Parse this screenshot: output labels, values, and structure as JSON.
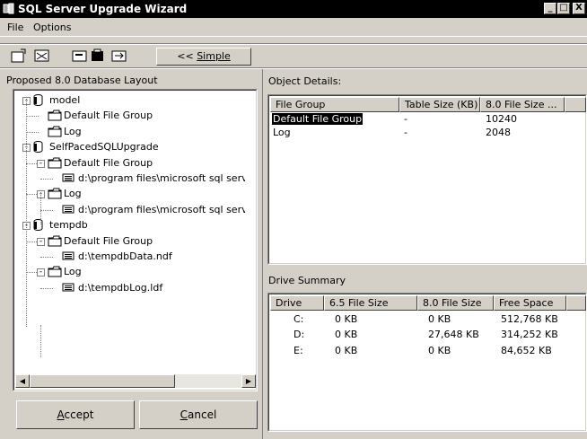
{
  "window": {
    "title": "SQL Server Upgrade Wizard",
    "controls": [
      "_",
      "□",
      "X"
    ]
  },
  "menu": {
    "items": [
      "File",
      "Options"
    ]
  },
  "toolbar": {
    "simple_prefix": "<< ",
    "simple_label": "Simple"
  },
  "left_panel": {
    "label": "Proposed 8.0 Database Layout",
    "tree": [
      {
        "depth": 0,
        "icon": "database-icon",
        "text": "model",
        "expander": "-"
      },
      {
        "depth": 1,
        "icon": "folder-icon",
        "text": "Default File Group"
      },
      {
        "depth": 1,
        "icon": "folder-icon",
        "text": "Log"
      },
      {
        "depth": 0,
        "icon": "database-icon",
        "text": "SelfPacedSQLUpgrade",
        "expander": "-"
      },
      {
        "depth": 1,
        "icon": "folder-icon",
        "text": "Default File Group",
        "expander": "-"
      },
      {
        "depth": 2,
        "icon": "file-icon",
        "text": "d:\\program files\\microsoft sql serv"
      },
      {
        "depth": 1,
        "icon": "folder-icon",
        "text": "Log",
        "expander": "-"
      },
      {
        "depth": 2,
        "icon": "file-icon",
        "text": "d:\\program files\\microsoft sql serv"
      },
      {
        "depth": 0,
        "icon": "database-icon",
        "text": "tempdb",
        "expander": "-"
      },
      {
        "depth": 1,
        "icon": "folder-icon",
        "text": "Default File Group",
        "expander": "-"
      },
      {
        "depth": 2,
        "icon": "file-icon",
        "text": "d:\\tempdbData.ndf"
      },
      {
        "depth": 1,
        "icon": "folder-icon",
        "text": "Log",
        "expander": "-"
      },
      {
        "depth": 2,
        "icon": "file-icon",
        "text": "d:\\tempdbLog.ldf"
      }
    ]
  },
  "buttons": {
    "accept_hotkey": "A",
    "accept_rest": "ccept",
    "cancel_hotkey": "C",
    "cancel_rest": "ancel"
  },
  "object_details": {
    "label": "Object Details:",
    "headers": [
      "File Group",
      "Table Size (KB)",
      "8.0 File Size ..."
    ],
    "rows": [
      [
        "Default File Group",
        "-",
        "10240"
      ],
      [
        "Log",
        "-",
        "2048"
      ]
    ]
  },
  "drive_summary": {
    "label": "Drive Summary",
    "headers": [
      "Drive",
      "6.5 File Size",
      "8.0 File Size",
      "Free Space"
    ],
    "rows": [
      [
        "C:",
        "0 KB",
        "0 KB",
        "512,768 KB"
      ],
      [
        "D:",
        "0 KB",
        "27,648 KB",
        "314,252 KB"
      ],
      [
        "E:",
        "0 KB",
        "0 KB",
        "84,652 KB"
      ]
    ]
  }
}
